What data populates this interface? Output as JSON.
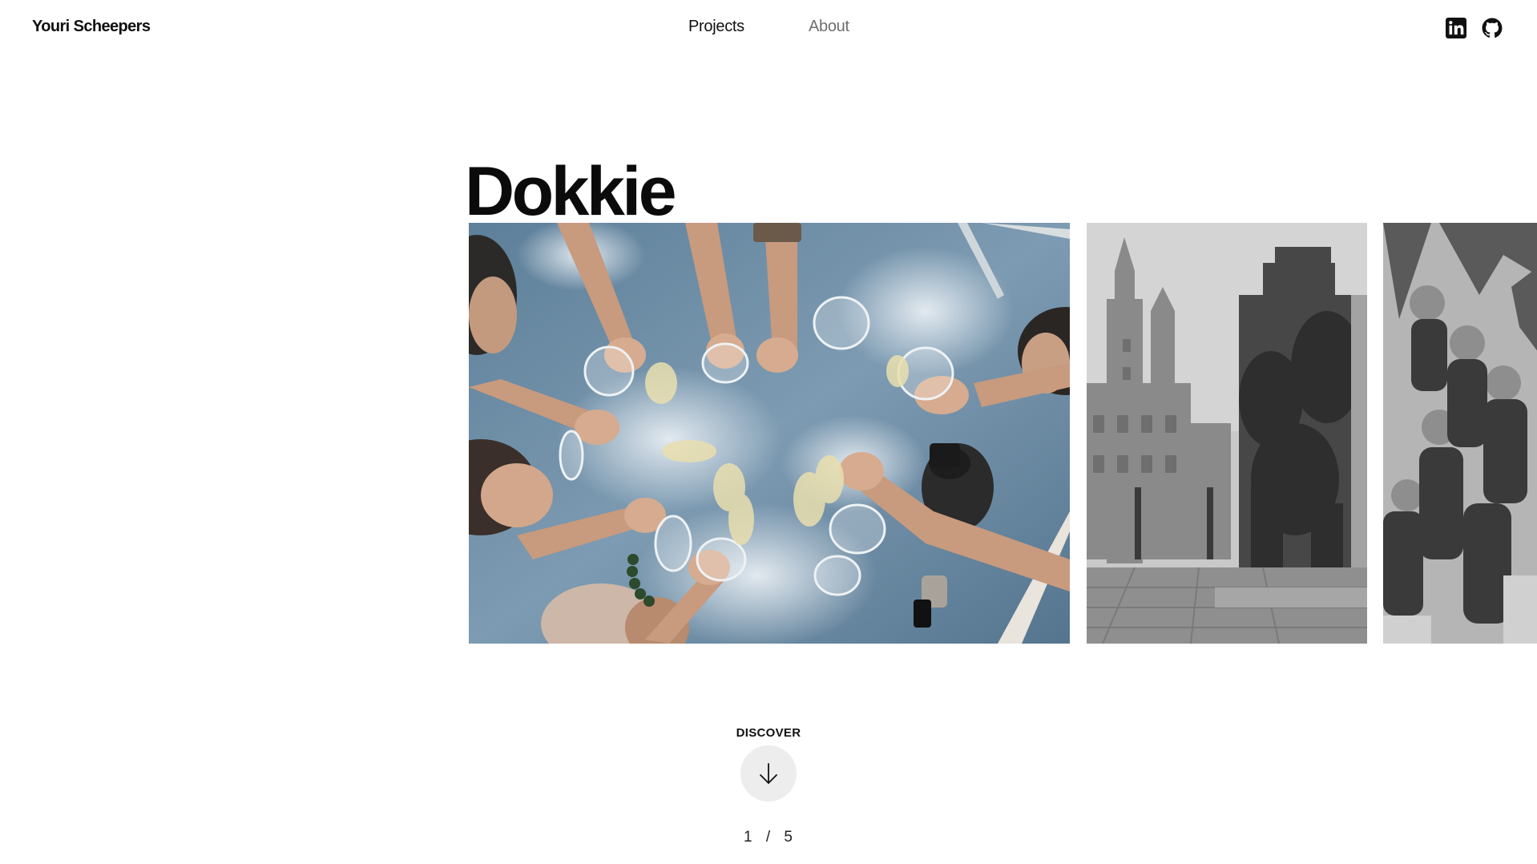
{
  "header": {
    "brand": "Youri Scheepers",
    "nav": [
      {
        "label": "Projects",
        "active": true
      },
      {
        "label": "About",
        "active": false
      }
    ],
    "socials": [
      {
        "icon": "linkedin-icon"
      },
      {
        "icon": "github-icon"
      }
    ]
  },
  "project": {
    "title": "Dokkie"
  },
  "gallery": [
    {
      "subject": "toast-glasses-photo"
    },
    {
      "subject": "minecraft-castle-photo"
    },
    {
      "subject": "group-photo"
    }
  ],
  "discover": {
    "label": "DISCOVER",
    "icon": "arrow-down-icon"
  },
  "pager": {
    "current": "1",
    "separator": "/",
    "total": "5"
  },
  "colors": {
    "text": "#111111",
    "muted_nav": "#6f6f6f",
    "discover_bg": "#ededed"
  }
}
